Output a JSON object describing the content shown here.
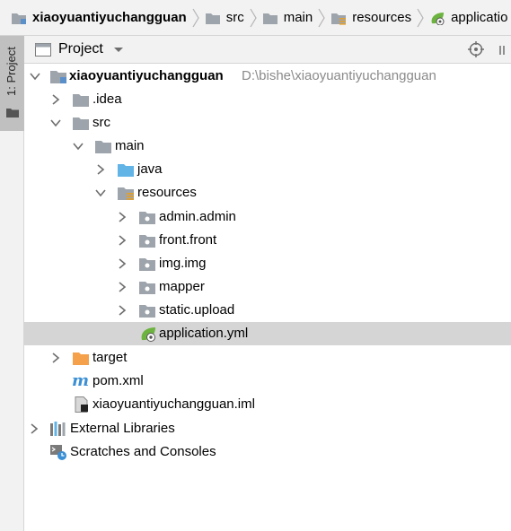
{
  "breadcrumb": {
    "items": [
      {
        "label": "xiaoyuantiyuchangguan",
        "icon": "module-folder-icon"
      },
      {
        "label": "src",
        "icon": "folder-icon"
      },
      {
        "label": "main",
        "icon": "folder-icon"
      },
      {
        "label": "resources",
        "icon": "resources-folder-icon"
      },
      {
        "label": "applicatio",
        "icon": "spring-leaf-icon"
      }
    ]
  },
  "toolwindow": {
    "side_tab_label": "1: Project"
  },
  "panel": {
    "title": "Project"
  },
  "tree": {
    "root": {
      "label": "xiaoyuantiyuchangguan",
      "path": "D:\\bishe\\xiaoyuantiyuchangguan"
    },
    "idea": "idea",
    "src": "src",
    "main": "main",
    "java": "java",
    "resources": "resources",
    "pkg_admin": "admin.admin",
    "pkg_front": "front.front",
    "pkg_img": "img.img",
    "pkg_mapper": "mapper",
    "pkg_static": "static.upload",
    "application": "application.yml",
    "target": "target",
    "pom": "pom.xml",
    "iml": "xiaoyuantiyuchangguan.iml",
    "external_libraries": "External Libraries",
    "scratches": "Scratches and Consoles"
  },
  "colors": {
    "folder_gray": "#9ea4ab",
    "folder_blue": "#62b3e6",
    "folder_orange": "#f5a04b",
    "spring_green": "#6db33f",
    "maven_blue": "#3b8fd4",
    "selection": "#d5d5d5"
  }
}
